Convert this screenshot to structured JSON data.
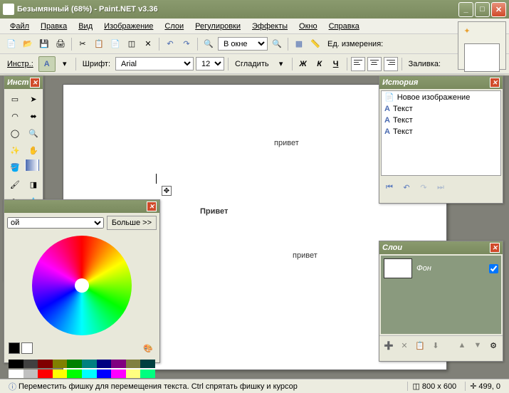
{
  "window": {
    "title": "Безымянный (68%) - Paint.NET v3.36"
  },
  "menu": {
    "file": "Файл",
    "edit": "Правка",
    "view": "Вид",
    "image": "Изображение",
    "layers": "Слои",
    "adjustments": "Регулировки",
    "effects": "Эффекты",
    "window": "Окно",
    "help": "Справка"
  },
  "toolbar1": {
    "zoom_mode": "В окне",
    "units_label": "Ед. измерения:"
  },
  "toolbar2": {
    "tool_label": "Инстр.:",
    "font_label": "Шрифт:",
    "font_name": "Arial",
    "font_size": "12",
    "smooth_label": "Сгладить",
    "fill_label": "Заливка:"
  },
  "tools_panel": {
    "title": "Инст"
  },
  "history_panel": {
    "title": "История",
    "items": [
      {
        "icon": "new",
        "label": "Новое изображение"
      },
      {
        "icon": "text",
        "label": "Текст"
      },
      {
        "icon": "text",
        "label": "Текст"
      },
      {
        "icon": "text",
        "label": "Текст"
      }
    ]
  },
  "layers_panel": {
    "title": "Слои",
    "layer0": "Фон"
  },
  "colors_panel": {
    "dropdown": "ой",
    "more_btn": "Больше >>"
  },
  "canvas": {
    "text1": "привет",
    "text2": "Привет",
    "text3": "привет"
  },
  "status": {
    "help_text": "Переместить фишку для перемещения текста. Ctrl спрятать фишку и курсор",
    "canvas_size": "800 x 600",
    "cursor_pos": "499, 0"
  },
  "palette": {
    "row1": [
      "#000",
      "#404040",
      "#800000",
      "#808000",
      "#008000",
      "#008080",
      "#000080",
      "#800080",
      "#808040",
      "#004040"
    ],
    "row2": [
      "#fff",
      "#c0c0c0",
      "#ff0000",
      "#ffff00",
      "#00ff00",
      "#00ffff",
      "#0000ff",
      "#ff00ff",
      "#ffff80",
      "#00ff80"
    ]
  }
}
